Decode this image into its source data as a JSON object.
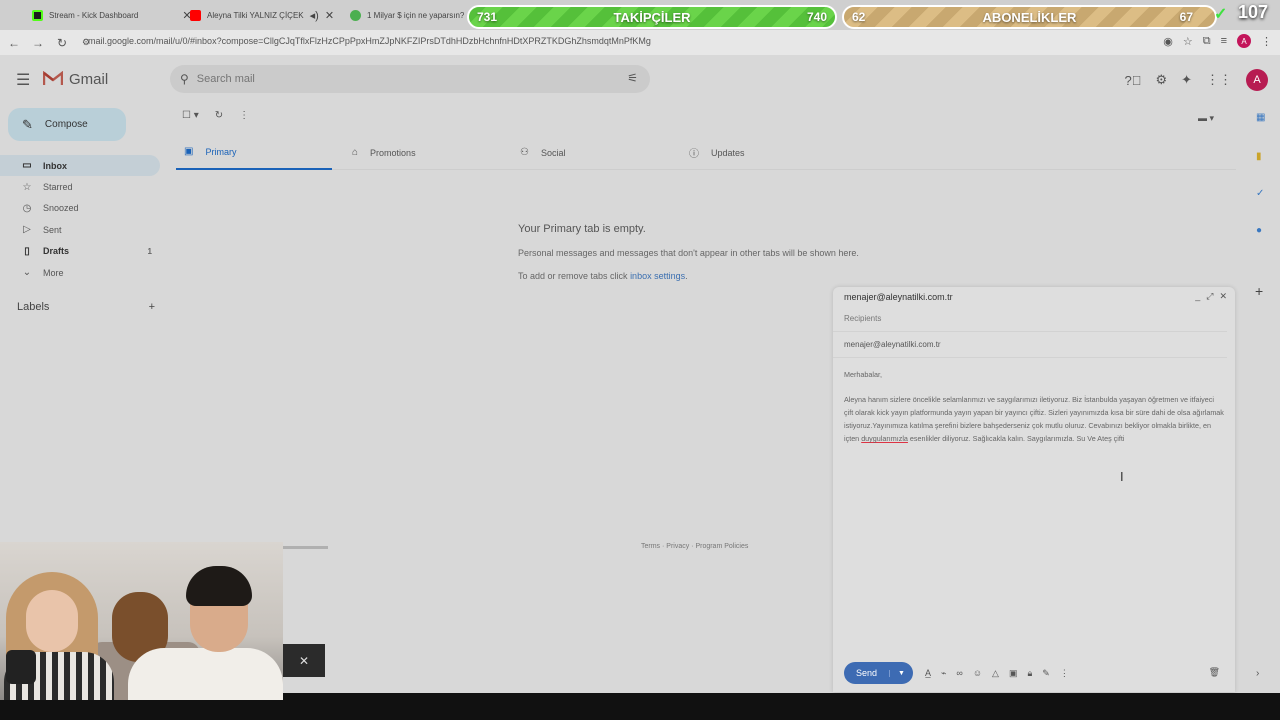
{
  "browser": {
    "tabs": [
      {
        "title": "Stream - Kick Dashboard",
        "color": "#53fc18"
      },
      {
        "title": "Aleyna Tilki YALNIZ ÇİÇEK",
        "color": "#ff0000"
      },
      {
        "title": "1 Milyar $ için ne yaparsın?",
        "color": "#4caf50"
      }
    ],
    "url": "mail.google.com/mail/u/0/#inbox?compose=CllgCJqTflxFlzHzCPpPpxHmZJpNKFZIPrsDTdhHDzbHchnfnHDtXPRZTKDGhZhsmdqtMnPfKMg",
    "avatar_letter": "A"
  },
  "overlay": {
    "followers": {
      "label": "TAKİPÇİLER",
      "current": "731",
      "goal": "740"
    },
    "subscribers": {
      "label": "ABONELİKLER",
      "current": "62",
      "goal": "67"
    },
    "count": "107"
  },
  "gmail": {
    "logo": "Gmail",
    "search_placeholder": "Search mail",
    "compose_label": "Compose",
    "sidebar": [
      {
        "label": "Inbox",
        "icon": "inbox-icon",
        "count": ""
      },
      {
        "label": "Starred",
        "icon": "star-icon",
        "count": ""
      },
      {
        "label": "Snoozed",
        "icon": "clock-icon",
        "count": ""
      },
      {
        "label": "Sent",
        "icon": "send-icon",
        "count": ""
      },
      {
        "label": "Drafts",
        "icon": "draft-icon",
        "count": "1"
      },
      {
        "label": "More",
        "icon": "chevron-down-icon",
        "count": ""
      }
    ],
    "labels_title": "Labels",
    "tabs": [
      "Primary",
      "Promotions",
      "Social",
      "Updates"
    ],
    "empty": {
      "title": "Your Primary tab is empty.",
      "desc": "Personal messages and messages that don't appear in other tabs will be shown here.",
      "tabs_text": "To add or remove tabs click ",
      "tabs_link": "inbox settings",
      "tabs_end": "."
    },
    "footer": "Terms · Privacy · Program Policies",
    "avatar_letter": "A"
  },
  "compose_window": {
    "title": "menajer@aleynatilki.com.tr",
    "recipients_placeholder": "Recipients",
    "to": "menajer@aleynatilki.com.tr",
    "greeting": "Merhabalar,",
    "body_before": "Aleyna hanım sizlere öncelikle selamlarımızı ve saygılarımızı iletiyoruz. Biz İstanbulda yaşayan öğretmen ve itfaiyeci çift olarak kick yayın platformunda yayın yapan bir yayıncı çiftiz. Sizleri yayınımızda kısa bir süre dahi de olsa ağırlamak istiyoruz.Yayınımıza katılma şerefini bizlere bahşederseniz çok mutlu oluruz. Cevabınızı bekliyor olmakla birlikte, en içten ",
    "body_underlined": "duygularımızla",
    "body_after": " esenlikler diliyoruz. Sağlıcakla kalın. Saygılarımızla.  Su Ve Ateş çifti",
    "send_label": "Send"
  }
}
